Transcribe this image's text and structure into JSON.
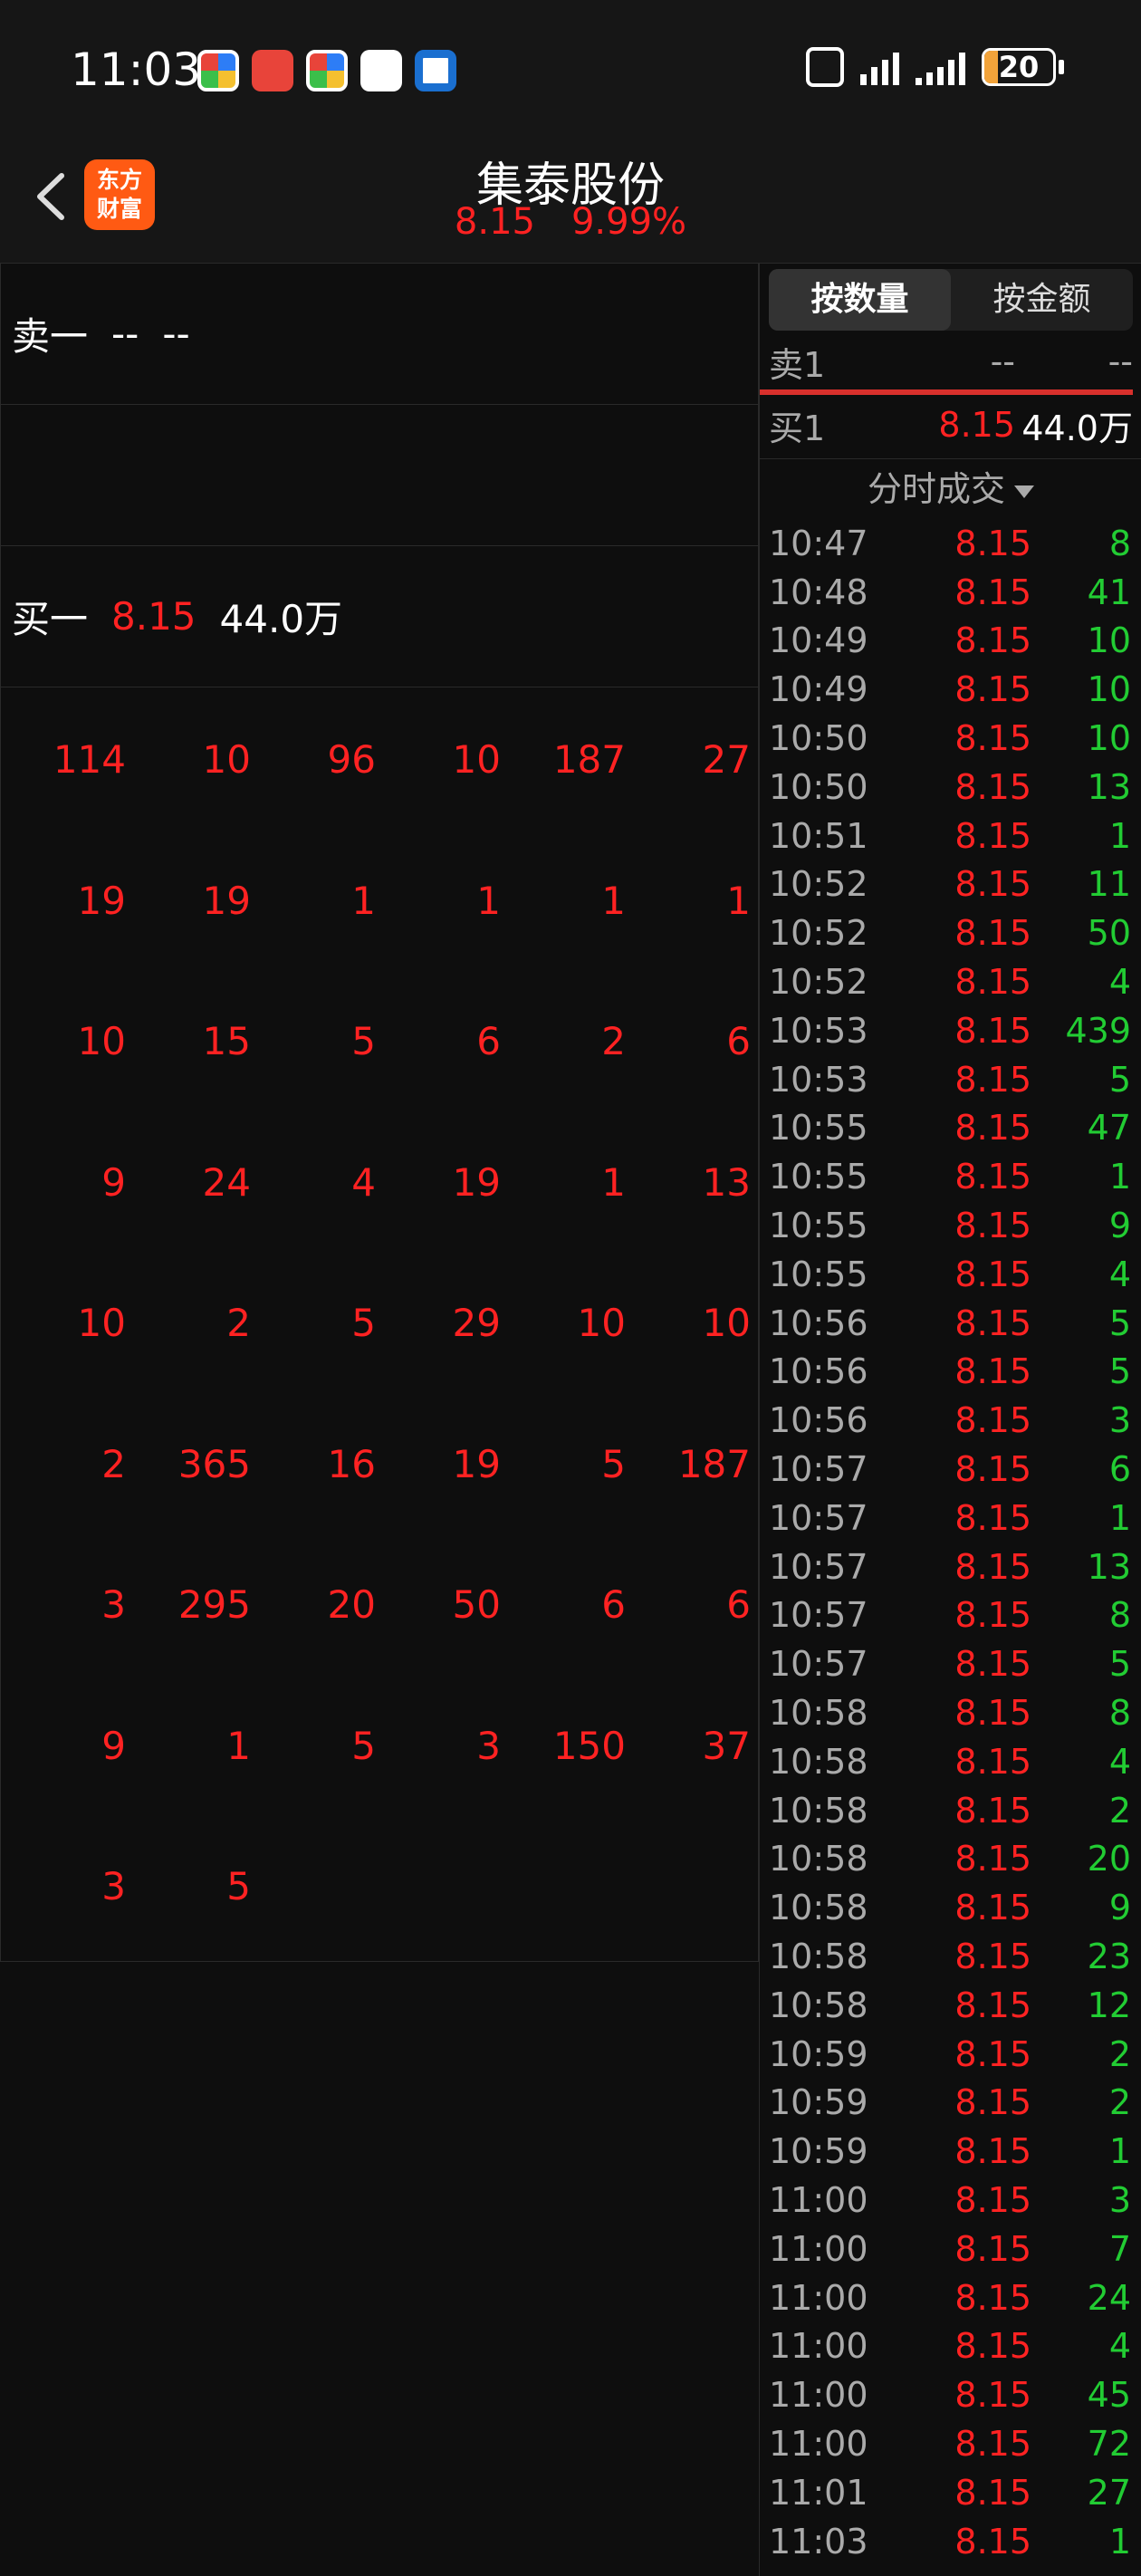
{
  "status_bar": {
    "time": "11:03",
    "battery": "20",
    "battery_level": 0.2,
    "app_icons": [
      "app-icon-1",
      "app-icon-2",
      "app-icon-3",
      "app-icon-4",
      "app-icon-5"
    ]
  },
  "header": {
    "logo": "东方\n财富",
    "title": "集泰股份",
    "price": "8.15",
    "change_pct": "9.99%"
  },
  "order_book": {
    "sell1_label": "卖一",
    "sell1_price": "--",
    "sell1_vol": "--",
    "buy1_label": "买一",
    "buy1_price": "8.15",
    "buy1_vol": "44.0万"
  },
  "queue": [
    [
      "114",
      "10",
      "96",
      "10",
      "187",
      "27"
    ],
    [
      "19",
      "19",
      "1",
      "1",
      "1",
      "1"
    ],
    [
      "10",
      "15",
      "5",
      "6",
      "2",
      "6"
    ],
    [
      "9",
      "24",
      "4",
      "19",
      "1",
      "13"
    ],
    [
      "10",
      "2",
      "5",
      "29",
      "10",
      "10"
    ],
    [
      "2",
      "365",
      "16",
      "19",
      "5",
      "187"
    ],
    [
      "3",
      "295",
      "20",
      "50",
      "6",
      "6"
    ],
    [
      "9",
      "1",
      "5",
      "3",
      "150",
      "37"
    ],
    [
      "3",
      "5"
    ]
  ],
  "right_panel": {
    "tab_qty": "按数量",
    "tab_amount": "按金额",
    "sell1": {
      "label": "卖1",
      "price": "--",
      "vol": "--"
    },
    "buy1": {
      "label": "买1",
      "price": "8.15",
      "vol": "44.0万"
    },
    "trades_header": "分时成交"
  },
  "trades": [
    [
      "10:47",
      "8.15",
      "8"
    ],
    [
      "10:48",
      "8.15",
      "41"
    ],
    [
      "10:49",
      "8.15",
      "10"
    ],
    [
      "10:49",
      "8.15",
      "10"
    ],
    [
      "10:50",
      "8.15",
      "10"
    ],
    [
      "10:50",
      "8.15",
      "13"
    ],
    [
      "10:51",
      "8.15",
      "1"
    ],
    [
      "10:52",
      "8.15",
      "11"
    ],
    [
      "10:52",
      "8.15",
      "50"
    ],
    [
      "10:52",
      "8.15",
      "4"
    ],
    [
      "10:53",
      "8.15",
      "439"
    ],
    [
      "10:53",
      "8.15",
      "5"
    ],
    [
      "10:55",
      "8.15",
      "47"
    ],
    [
      "10:55",
      "8.15",
      "1"
    ],
    [
      "10:55",
      "8.15",
      "9"
    ],
    [
      "10:55",
      "8.15",
      "4"
    ],
    [
      "10:56",
      "8.15",
      "5"
    ],
    [
      "10:56",
      "8.15",
      "5"
    ],
    [
      "10:56",
      "8.15",
      "3"
    ],
    [
      "10:57",
      "8.15",
      "6"
    ],
    [
      "10:57",
      "8.15",
      "1"
    ],
    [
      "10:57",
      "8.15",
      "13"
    ],
    [
      "10:57",
      "8.15",
      "8"
    ],
    [
      "10:57",
      "8.15",
      "5"
    ],
    [
      "10:58",
      "8.15",
      "8"
    ],
    [
      "10:58",
      "8.15",
      "4"
    ],
    [
      "10:58",
      "8.15",
      "2"
    ],
    [
      "10:58",
      "8.15",
      "20"
    ],
    [
      "10:58",
      "8.15",
      "9"
    ],
    [
      "10:58",
      "8.15",
      "23"
    ],
    [
      "10:58",
      "8.15",
      "12"
    ],
    [
      "10:59",
      "8.15",
      "2"
    ],
    [
      "10:59",
      "8.15",
      "2"
    ],
    [
      "10:59",
      "8.15",
      "1"
    ],
    [
      "11:00",
      "8.15",
      "3"
    ],
    [
      "11:00",
      "8.15",
      "7"
    ],
    [
      "11:00",
      "8.15",
      "24"
    ],
    [
      "11:00",
      "8.15",
      "4"
    ],
    [
      "11:00",
      "8.15",
      "45"
    ],
    [
      "11:00",
      "8.15",
      "72"
    ],
    [
      "11:01",
      "8.15",
      "27"
    ],
    [
      "11:03",
      "8.15",
      "1"
    ]
  ],
  "colors": {
    "up": "#ff2222",
    "down": "#22cc33",
    "bg": "#0e0e0e",
    "logo": "#ff5a13"
  }
}
